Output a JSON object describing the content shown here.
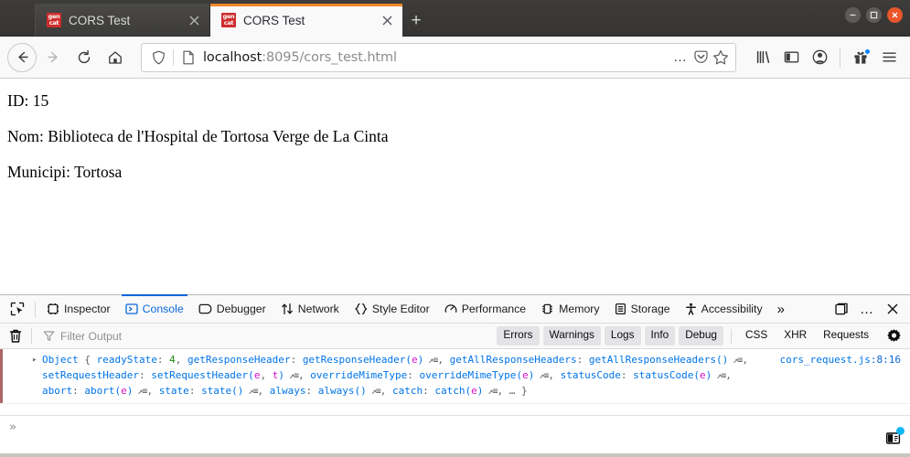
{
  "window": {
    "controls": {
      "minimize": "minimize",
      "maximize": "maximize",
      "close": "close"
    }
  },
  "tabs": [
    {
      "title": "CORS Test",
      "favicon_top": "gen",
      "favicon_bottom": "cat",
      "active": false
    },
    {
      "title": "CORS Test",
      "favicon_top": "gen",
      "favicon_bottom": "cat",
      "active": true
    }
  ],
  "newtab_label": "+",
  "navbar": {
    "back_label": "←",
    "forward_label": "→",
    "reload_label": "↻",
    "home_label": "home",
    "url_host": "localhost",
    "url_rest": ":8095/cors_test.html",
    "url_full": "localhost:8095/cors_test.html",
    "page_actions_label": "…",
    "pocket_label": "save-to-pocket",
    "bookmark_label": "bookmark",
    "library_label": "library",
    "sidebar_label": "sidebars",
    "account_label": "account",
    "extensions_label": "extensions",
    "menu_label": "open-menu"
  },
  "page": {
    "lines": [
      "ID: 15",
      "Nom: Biblioteca de l'Hospital de Tortosa Verge de La Cinta",
      "Municipi: Tortosa"
    ]
  },
  "devtools": {
    "picker_label": "element-picker",
    "tabs": [
      {
        "label": "Inspector",
        "selected": false
      },
      {
        "label": "Console",
        "selected": true
      },
      {
        "label": "Debugger",
        "selected": false
      },
      {
        "label": "Network",
        "selected": false
      },
      {
        "label": "Style Editor",
        "selected": false
      },
      {
        "label": "Performance",
        "selected": false
      },
      {
        "label": "Memory",
        "selected": false
      },
      {
        "label": "Storage",
        "selected": false
      },
      {
        "label": "Accessibility",
        "selected": false
      }
    ],
    "overflow_label": "»",
    "dock_label": "dock-position",
    "meatball_label": "…",
    "close_label": "✕",
    "filterbar": {
      "clear_label": "clear-console",
      "filter_placeholder": "Filter Output",
      "filter_value": "",
      "levels": [
        {
          "label": "Errors",
          "on": true
        },
        {
          "label": "Warnings",
          "on": true
        },
        {
          "label": "Logs",
          "on": true
        },
        {
          "label": "Info",
          "on": true
        },
        {
          "label": "Debug",
          "on": true
        }
      ],
      "categories": [
        {
          "label": "CSS",
          "on": false
        },
        {
          "label": "XHR",
          "on": false
        },
        {
          "label": "Requests",
          "on": false
        }
      ],
      "settings_label": "console-settings"
    },
    "messages": [
      {
        "twisty": "▸",
        "source": "cors_request.js",
        "source_line": ":8:16",
        "parts": [
          {
            "t": "Object ",
            "c": "tok-obj"
          },
          {
            "t": "{ ",
            "c": "tok-punc"
          },
          {
            "t": "readyState",
            "c": "tok-key"
          },
          {
            "t": ": ",
            "c": "tok-punc"
          },
          {
            "t": "4",
            "c": "tok-num"
          },
          {
            "t": ", ",
            "c": "tok-punc"
          },
          {
            "t": "getResponseHeader",
            "c": "tok-key"
          },
          {
            "t": ": ",
            "c": "tok-punc"
          },
          {
            "t": "getResponseHeader(",
            "c": "tok-fn"
          },
          {
            "t": "e",
            "c": "tok-param"
          },
          {
            "t": ")",
            "c": "tok-fn"
          },
          {
            "t": " ↗≡",
            "c": "arrowglyph"
          },
          {
            "t": ", ",
            "c": "tok-punc"
          },
          {
            "t": "getAllResponseHeaders",
            "c": "tok-key"
          },
          {
            "t": ": ",
            "c": "tok-punc"
          },
          {
            "t": "getAllResponseHeaders()",
            "c": "tok-fn"
          },
          {
            "t": " ↗≡",
            "c": "arrowglyph"
          },
          {
            "t": ", ",
            "c": "tok-punc"
          },
          {
            "t": "setRequestHeader",
            "c": "tok-key"
          },
          {
            "t": ": ",
            "c": "tok-punc"
          },
          {
            "t": "setRequestHeader(",
            "c": "tok-fn"
          },
          {
            "t": "e",
            "c": "tok-param"
          },
          {
            "t": ", ",
            "c": "tok-punc"
          },
          {
            "t": "t",
            "c": "tok-param"
          },
          {
            "t": ")",
            "c": "tok-fn"
          },
          {
            "t": " ↗≡",
            "c": "arrowglyph"
          },
          {
            "t": ", ",
            "c": "tok-punc"
          },
          {
            "t": "overrideMimeType",
            "c": "tok-key"
          },
          {
            "t": ": ",
            "c": "tok-punc"
          },
          {
            "t": "overrideMimeType(",
            "c": "tok-fn"
          },
          {
            "t": "e",
            "c": "tok-param"
          },
          {
            "t": ")",
            "c": "tok-fn"
          },
          {
            "t": " ↗≡",
            "c": "arrowglyph"
          },
          {
            "t": ", ",
            "c": "tok-punc"
          },
          {
            "t": "statusCode",
            "c": "tok-key"
          },
          {
            "t": ": ",
            "c": "tok-punc"
          },
          {
            "t": "statusCode(",
            "c": "tok-fn"
          },
          {
            "t": "e",
            "c": "tok-param"
          },
          {
            "t": ")",
            "c": "tok-fn"
          },
          {
            "t": " ↗≡",
            "c": "arrowglyph"
          },
          {
            "t": ", ",
            "c": "tok-punc"
          },
          {
            "t": "abort",
            "c": "tok-key"
          },
          {
            "t": ": ",
            "c": "tok-punc"
          },
          {
            "t": "abort(",
            "c": "tok-fn"
          },
          {
            "t": "e",
            "c": "tok-param"
          },
          {
            "t": ")",
            "c": "tok-fn"
          },
          {
            "t": " ↗≡",
            "c": "arrowglyph"
          },
          {
            "t": ", ",
            "c": "tok-punc"
          },
          {
            "t": "state",
            "c": "tok-key"
          },
          {
            "t": ": ",
            "c": "tok-punc"
          },
          {
            "t": "state()",
            "c": "tok-fn"
          },
          {
            "t": " ↗≡",
            "c": "arrowglyph"
          },
          {
            "t": ", ",
            "c": "tok-punc"
          },
          {
            "t": "always",
            "c": "tok-key"
          },
          {
            "t": ": ",
            "c": "tok-punc"
          },
          {
            "t": "always()",
            "c": "tok-fn"
          },
          {
            "t": " ↗≡",
            "c": "arrowglyph"
          },
          {
            "t": ", ",
            "c": "tok-punc"
          },
          {
            "t": "catch",
            "c": "tok-key"
          },
          {
            "t": ": ",
            "c": "tok-punc"
          },
          {
            "t": "catch(",
            "c": "tok-fn"
          },
          {
            "t": "e",
            "c": "tok-param"
          },
          {
            "t": ")",
            "c": "tok-fn"
          },
          {
            "t": " ↗≡",
            "c": "arrowglyph"
          },
          {
            "t": ", ",
            "c": "tok-punc"
          },
          {
            "t": "… }",
            "c": "tok-punc"
          }
        ],
        "plain": "Object { readyState: 4, getResponseHeader: getResponseHeader(e), getAllResponseHeaders: getAllResponseHeaders(), setRequestHeader: setRequestHeader(e, t), overrideMimeType: overrideMimeType(e), statusCode: statusCode(e), abort: abort(e), state: state(), always: always(), catch: catch(e), … }"
      }
    ],
    "prompt_symbol": "»",
    "prompt_value": "",
    "split_console_label": "split-console"
  },
  "colors": {
    "accent": "#0a66d9",
    "tab_accent": "#f0862a",
    "close_button": "#e8562c",
    "console_blue": "#0074e8",
    "console_magenta": "#d613c7",
    "console_green": "#1d8e0f",
    "favicon_red": "#cf2d2d",
    "notification_dot": "#0a84ff"
  }
}
